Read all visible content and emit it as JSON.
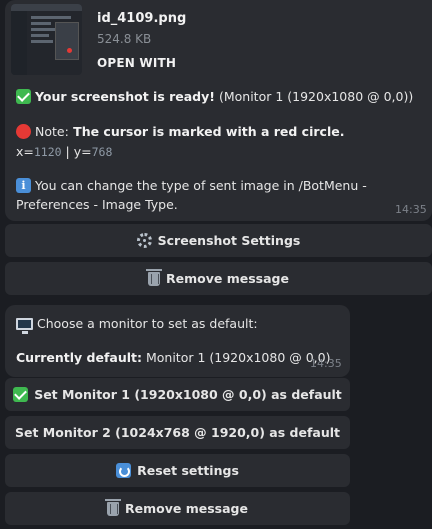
{
  "message1": {
    "file_name": "id_4109.png",
    "file_size": "524.8 KB",
    "open_with": "OPEN WITH",
    "ready_bold": "Your screenshot is ready!",
    "ready_rest": " (Monitor 1 (1920x1080 @ 0,0))",
    "note_label": "Note:",
    "note_bold": " The cursor is marked with a red circle.",
    "x_label": "x=",
    "x_value": "1120",
    "sep": " | ",
    "y_label": "y=",
    "y_value": "768",
    "info_line1": "You can change the type of sent image in /BotMenu -",
    "info_line2": "Preferences - Image Type.",
    "time": "14:35"
  },
  "buttons1": {
    "screenshot_settings": "Screenshot Settings",
    "remove_message": "Remove message"
  },
  "message2": {
    "choose_text": "Choose a monitor to set as default:",
    "current_label": "Currently default:",
    "current_value": " Monitor 1 (1920x1080 @ 0,0)",
    "time": "14:35"
  },
  "buttons2": {
    "set_monitor_1": "Set Monitor 1 (1920x1080 @ 0,0) as default",
    "set_monitor_2": "Set Monitor 2 (1024x768 @ 1920,0) as default",
    "reset_settings": "Reset settings",
    "remove_message": "Remove message"
  },
  "icons": {
    "check": "check-mark-icon",
    "red_circle": "red-circle-icon",
    "info": "info-icon",
    "monitor": "monitor-icon",
    "gear": "gear-icon",
    "trash": "trash-icon",
    "reset": "reset-icon"
  },
  "colors": {
    "background": "#1b1d22",
    "bubble": "#2a2c31",
    "accent_green": "#3fb950",
    "accent_red": "#e53935",
    "accent_blue": "#4a8fd8"
  }
}
